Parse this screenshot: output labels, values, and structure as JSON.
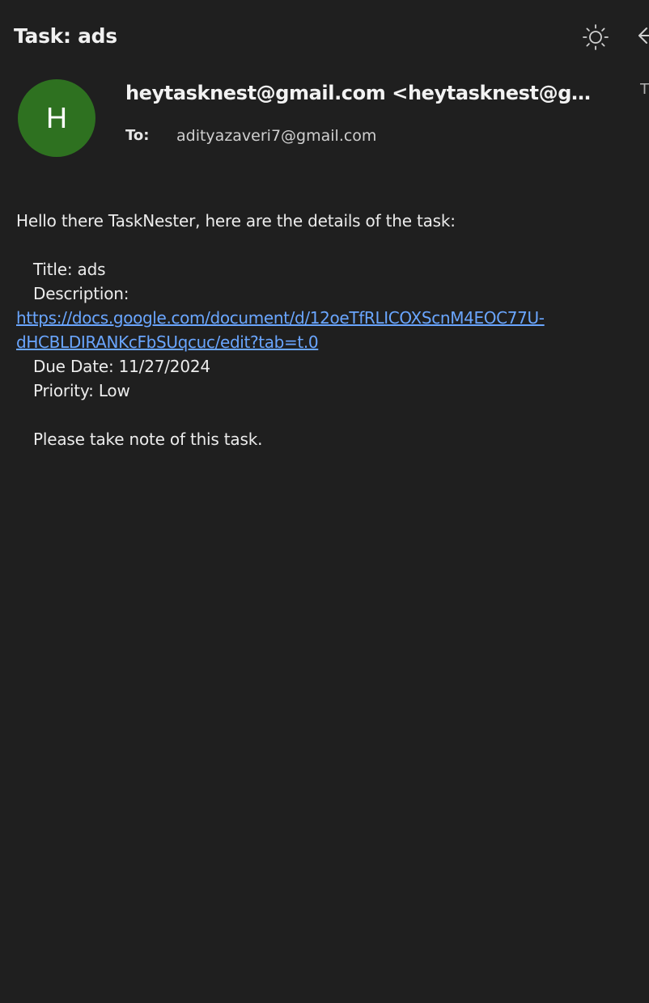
{
  "header": {
    "subject": "Task: ads",
    "icons": {
      "theme_toggle": "sun-icon",
      "back": "arrow-left-icon"
    },
    "overflow_text": "T"
  },
  "sender": {
    "avatar_initial": "H",
    "avatar_color": "#2e7120",
    "from": "heytasknest@gmail.com <heytasknest@gmail.com>",
    "to_label": "To:",
    "to_value": "adityazaveri7@gmail.com"
  },
  "message": {
    "greeting": "Hello there TaskNester, here are the details of the task:",
    "title_line": "Title: ads",
    "description_label": "Description:",
    "description_link_line1": "https://docs.google.com/document/d/12oeTfRLICOXScnM4EOC77U-",
    "description_link_line2": "dHCBLDIRANKcFbSUqcuc/edit?tab=t.0",
    "due_date_line": "Due Date: 11/27/2024",
    "priority_line": "Priority: Low",
    "closing": "Please take note of this task."
  },
  "colors": {
    "background": "#1f1f1f",
    "link": "#6aa6ff",
    "text": "#ececec"
  }
}
